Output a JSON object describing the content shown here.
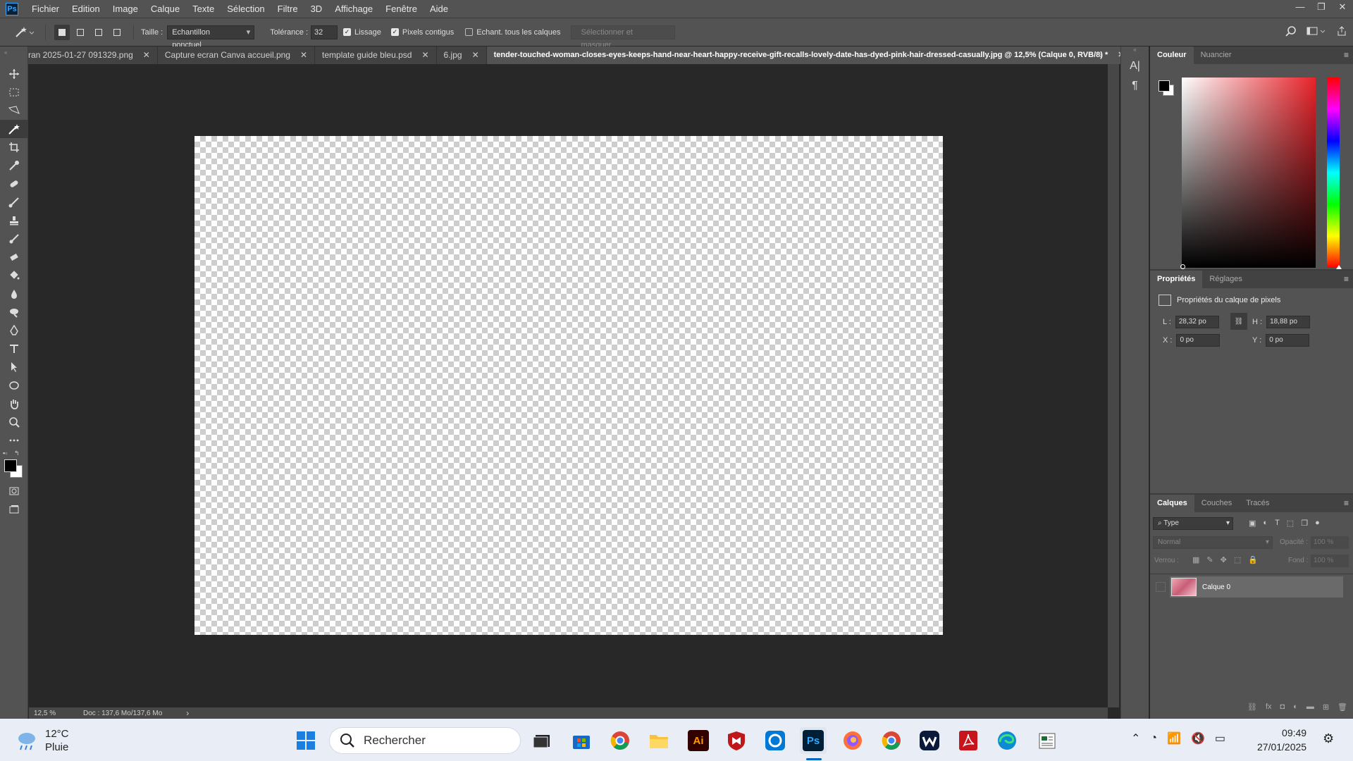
{
  "app": {
    "name": "Ps",
    "accent": "#31a8ff"
  },
  "menu": [
    "Fichier",
    "Edition",
    "Image",
    "Calque",
    "Texte",
    "Sélection",
    "Filtre",
    "3D",
    "Affichage",
    "Fenêtre",
    "Aide"
  ],
  "window_controls": {
    "minimize": "—",
    "restore": "❐",
    "close": "✕"
  },
  "options": {
    "size_label": "Taille :",
    "size_value": "Echantillon ponctuel",
    "tolerance_label": "Tolérance :",
    "tolerance_value": "32",
    "antialias_label": "Lissage",
    "contiguous_label": "Pixels contigus",
    "sample_all_label": "Echant. tous les calques",
    "select_mask_label": "Sélectionner et masquer..."
  },
  "tabs": [
    {
      "label": "ran 2025-01-27 091329.png"
    },
    {
      "label": "Capture ecran Canva accueil.png"
    },
    {
      "label": "template guide bleu.psd"
    },
    {
      "label": "6.jpg"
    },
    {
      "label": "tender-touched-woman-closes-eyes-keeps-hand-near-heart-happy-receive-gift-recalls-lovely-date-has-dyed-pink-hair-dressed-casually.jpg @ 12,5% (Calque 0, RVB/8) *"
    }
  ],
  "status": {
    "zoom": "12,5 %",
    "doc": "Doc : 137,6 Mo/137,6 Mo",
    "arrow": "›"
  },
  "color_panel": {
    "tabs": [
      "Couleur",
      "Nuancier"
    ],
    "hue_color": "#e8232a"
  },
  "properties_panel": {
    "tabs": [
      "Propriétés",
      "Réglages"
    ],
    "title": "Propriétés du calque de pixels",
    "w_label": "L :",
    "w_value": "28,32 po",
    "h_label": "H :",
    "h_value": "18,88 po",
    "x_label": "X :",
    "x_value": "0 po",
    "y_label": "Y :",
    "y_value": "0 po"
  },
  "layers_panel": {
    "tabs": [
      "Calques",
      "Couches",
      "Tracés"
    ],
    "filter_value": "Type",
    "blend_mode": "Normal",
    "opacity_label": "Opacité :",
    "opacity_value": "100 %",
    "lock_label": "Verrou :",
    "fill_label": "Fond :",
    "fill_value": "100 %",
    "layers": [
      {
        "name": "Calque 0"
      }
    ]
  },
  "taskbar": {
    "temperature": "12°C",
    "weather": "Pluie",
    "search_placeholder": "Rechercher",
    "time": "09:49",
    "date": "27/01/2025"
  }
}
